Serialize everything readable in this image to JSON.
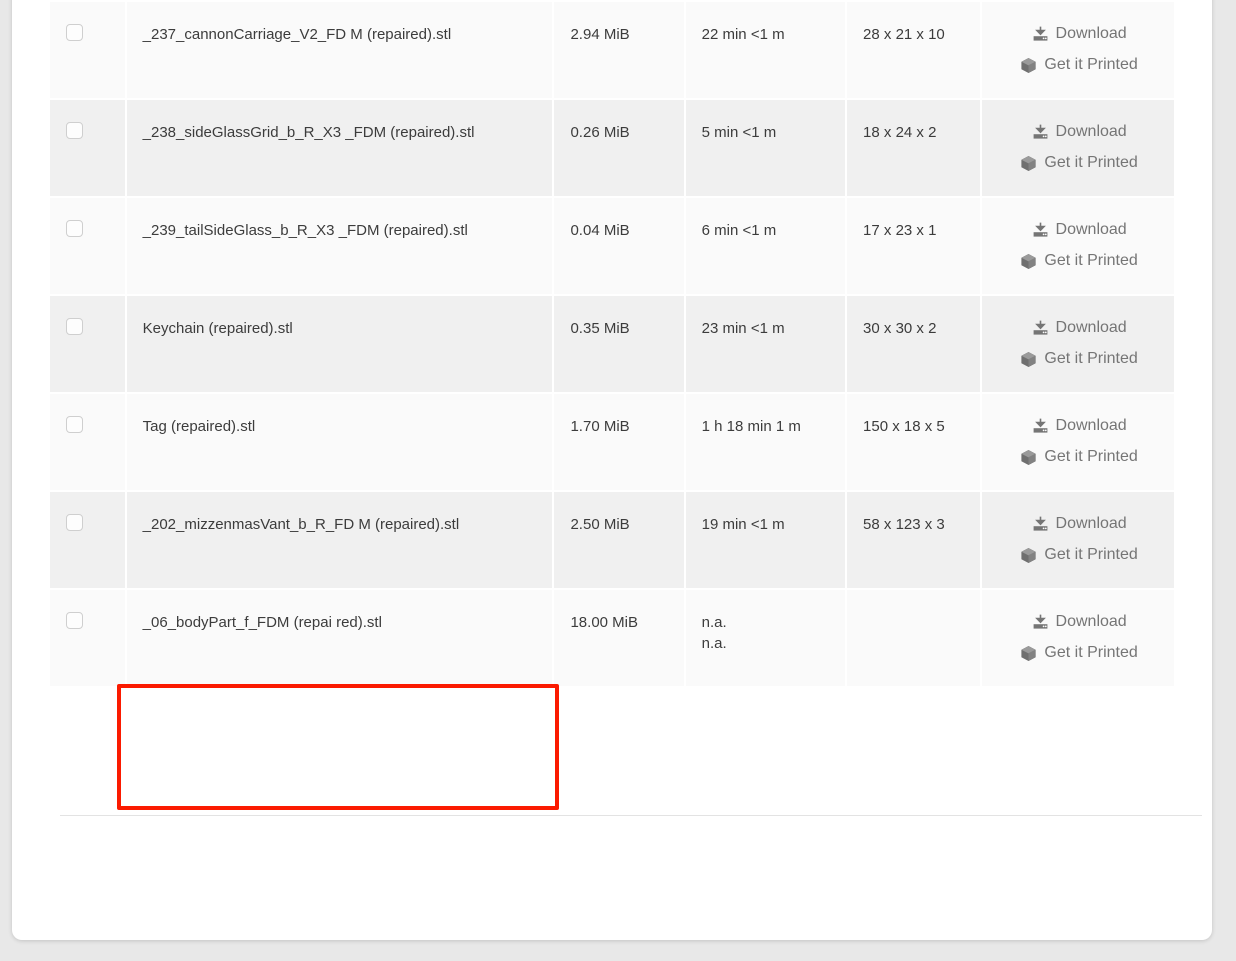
{
  "table": {
    "rows": [
      {
        "name": "_237_cannonCarriage_V2_FD M (repaired).stl",
        "size": "2.94 MiB",
        "time": "22 min <1 m",
        "dimensions": "28 x 21 x 10",
        "download_label": "Download",
        "print_label": "Get it Printed"
      },
      {
        "name": "_238_sideGlassGrid_b_R_X3 _FDM (repaired).stl",
        "size": "0.26 MiB",
        "time": "5 min <1 m",
        "dimensions": "18 x 24 x 2",
        "download_label": "Download",
        "print_label": "Get it Printed"
      },
      {
        "name": "_239_tailSideGlass_b_R_X3 _FDM (repaired).stl",
        "size": "0.04 MiB",
        "time": "6 min <1 m",
        "dimensions": "17 x 23 x 1",
        "download_label": "Download",
        "print_label": "Get it Printed"
      },
      {
        "name": "Keychain (repaired).stl",
        "size": "0.35 MiB",
        "time": "23 min <1 m",
        "dimensions": "30 x 30 x 2",
        "download_label": "Download",
        "print_label": "Get it Printed"
      },
      {
        "name": "Tag (repaired).stl",
        "size": "1.70 MiB",
        "time": "1 h 18 min 1 m",
        "dimensions": "150 x 18 x 5",
        "download_label": "Download",
        "print_label": "Get it Printed"
      },
      {
        "name": "_202_mizzenmasVant_b_R_FD M (repaired).stl",
        "size": "2.50 MiB",
        "time": "19 min <1 m",
        "dimensions": "58 x 123 x 3",
        "download_label": "Download",
        "print_label": "Get it Printed"
      },
      {
        "name": "_06_bodyPart_f_FDM (repai red).stl",
        "size": "18.00 MiB",
        "time": "n.a.\nn.a.",
        "dimensions": "",
        "download_label": "Download",
        "print_label": "Get it Printed"
      }
    ]
  },
  "icons": {
    "checkbox": "checkbox-icon",
    "download": "download-icon",
    "print": "cube-icon"
  },
  "colors": {
    "highlight": "#fb1a00",
    "row_odd": "#fafafa",
    "row_even": "#f0f0f0",
    "text": "#3c3c3c",
    "action_text": "#757575"
  }
}
